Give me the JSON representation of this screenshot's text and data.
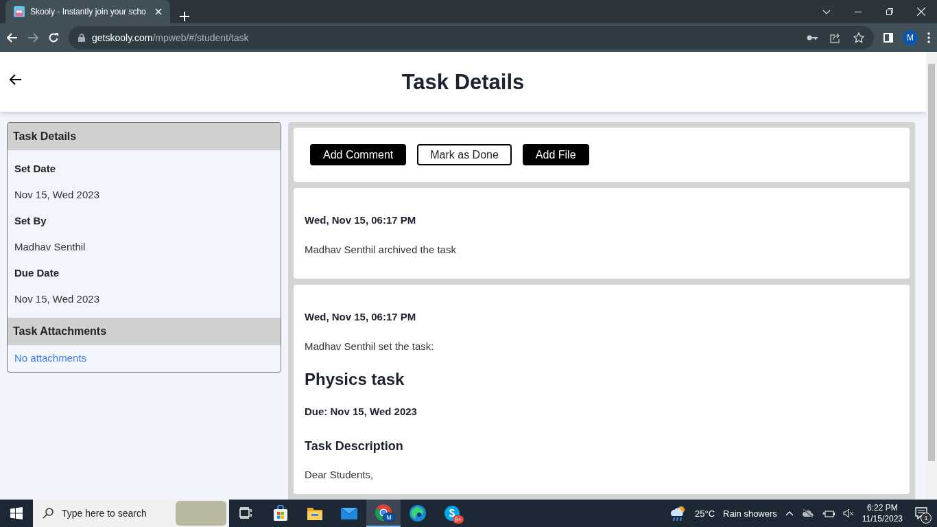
{
  "browser": {
    "tab_title": "Skooly - Instantly join your scho",
    "url_domain": "getskooly.com",
    "url_path": "/mpweb/#/student/task",
    "profile_initial": "M"
  },
  "header": {
    "title": "Task Details"
  },
  "sidebar": {
    "title": "Task Details",
    "fields": [
      {
        "label": "Set Date",
        "value": "Nov 15, Wed 2023"
      },
      {
        "label": "Set By",
        "value": "Madhav Senthil"
      },
      {
        "label": "Due Date",
        "value": "Nov 15, Wed 2023"
      }
    ],
    "attachments_title": "Task Attachments",
    "attachments_link": "No attachments"
  },
  "actions": [
    {
      "label": "Add Comment",
      "kind": "filled"
    },
    {
      "label": "Mark as Done",
      "kind": "outline"
    },
    {
      "label": "Add File",
      "kind": "filled"
    }
  ],
  "activity": [
    {
      "timestamp": "Wed, Nov 15, 06:17 PM",
      "message": "Madhav Senthil archived the task"
    },
    {
      "timestamp": "Wed, Nov 15, 06:17 PM",
      "message": "Madhav Senthil set the task:",
      "task_title": "Physics task",
      "due": "Due: Nov 15, Wed 2023",
      "description_heading": "Task Description",
      "description": "Dear Students,"
    }
  ],
  "taskbar": {
    "search_placeholder": "Type here to search",
    "apps": [
      {
        "kind": "taskview",
        "selected": false
      },
      {
        "kind": "store",
        "selected": false
      },
      {
        "kind": "explorer",
        "selected": false
      },
      {
        "kind": "mail",
        "selected": false
      },
      {
        "kind": "chrome",
        "selected": true,
        "badge": "M"
      },
      {
        "kind": "edge",
        "selected": false
      },
      {
        "kind": "skype",
        "selected": false,
        "badge": "9+"
      }
    ],
    "weather": {
      "temperature": "25°C",
      "condition": "Rain showers"
    },
    "clock": {
      "time": "6:22 PM",
      "date": "11/15/2023"
    },
    "notification_count": "1"
  }
}
